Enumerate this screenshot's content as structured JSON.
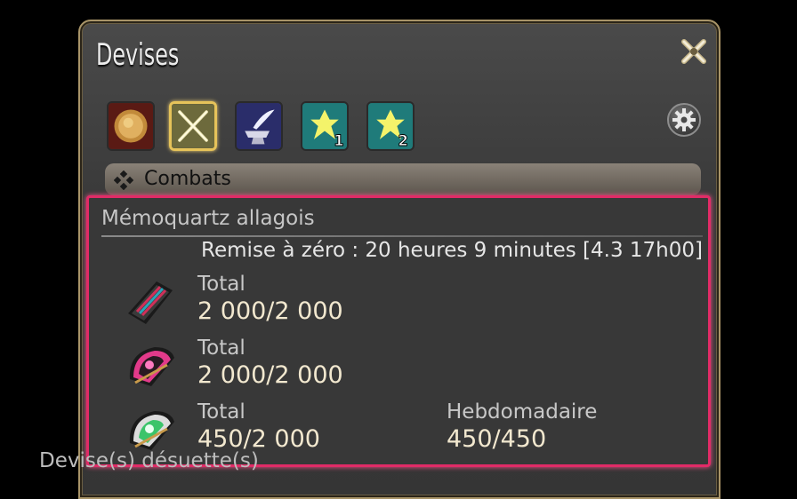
{
  "window": {
    "title": "Devises"
  },
  "tabs": [
    {
      "name": "gil-tab",
      "icon": "coin-icon",
      "selected": false
    },
    {
      "name": "combat-tab",
      "icon": "crossed-swords-icon",
      "selected": true
    },
    {
      "name": "crafting-tab",
      "icon": "anvil-quill-icon",
      "selected": false
    },
    {
      "name": "scrip-1-tab",
      "icon": "scrip-icon",
      "badge": "1",
      "selected": false
    },
    {
      "name": "scrip-2-tab",
      "icon": "scrip-icon",
      "badge": "2",
      "selected": false
    }
  ],
  "section": {
    "label": "Combats"
  },
  "panel": {
    "title": "Mémoquartz allagois",
    "reset_text": "Remise à zéro : 20 heures 9 minutes [4.3 17h00]",
    "items": [
      {
        "icon": "tomestone-red-icon",
        "total_label": "Total",
        "total_value": "2 000/2 000"
      },
      {
        "icon": "tomestone-pink-icon",
        "total_label": "Total",
        "total_value": "2 000/2 000"
      },
      {
        "icon": "tomestone-green-icon",
        "total_label": "Total",
        "total_value": "450/2 000",
        "weekly_label": "Hebdomadaire",
        "weekly_value": "450/450"
      }
    ]
  },
  "footer": {
    "label": "Devise(s) désuette(s)"
  },
  "colors": {
    "highlight_border": "#e12b67",
    "selected_tab_border": "#e6c35a",
    "value_text": "#f2e8cf"
  }
}
